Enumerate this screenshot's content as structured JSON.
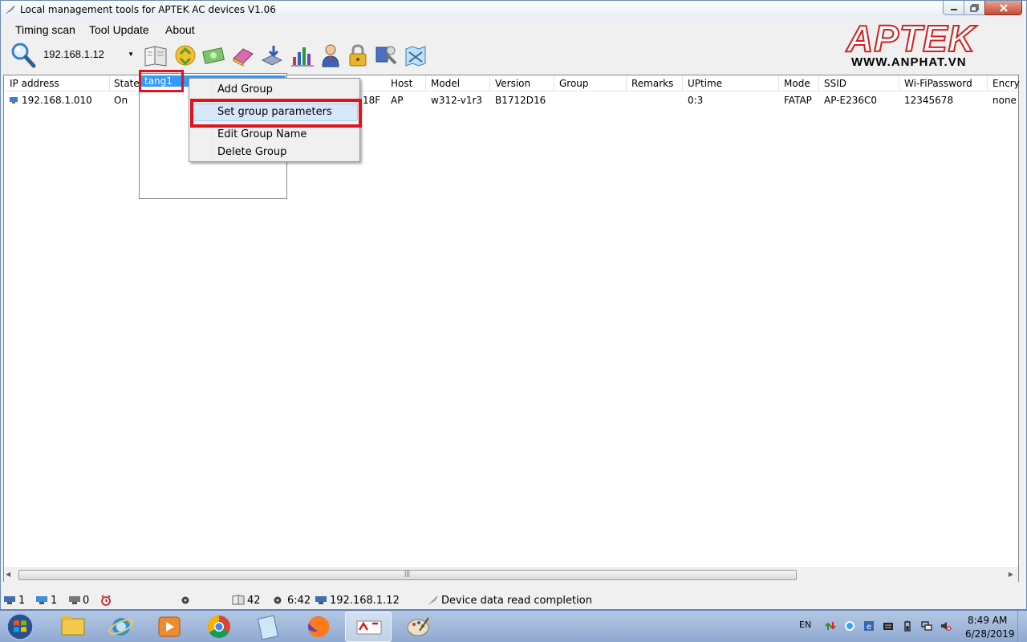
{
  "window": {
    "title": "Local management tools for APTEK AC devices  V1.06"
  },
  "menu": {
    "items": [
      "Timing scan",
      "Tool Update",
      "About"
    ]
  },
  "toolbar": {
    "ip_value": "192.168.1.12",
    "icons": [
      "book-icon",
      "recycle-icon",
      "money-icon",
      "eraser-icon",
      "download-icon",
      "bar-chart-icon",
      "user-icon",
      "lock-icon",
      "tools-icon",
      "map-icon"
    ]
  },
  "logo": {
    "word": "APTEK",
    "url": "WWW.ANPHAT.VN",
    "brand_color": "#d31f1f"
  },
  "table": {
    "columns": [
      "IP address",
      "State",
      "Host",
      "Model",
      "Version",
      "Group",
      "Remarks",
      "UPtime",
      "Mode",
      "SSID",
      "Wi-FiPassword",
      "Encry"
    ],
    "row": {
      "ip": "192.168.1.010",
      "state": "On",
      "mac_tail": "18F",
      "host": "AP",
      "model": "w312-v1r3",
      "version": "B1712D16",
      "group": "",
      "remarks": "",
      "uptime": "0:3",
      "mode": "FATAP",
      "ssid": "AP-E236C0",
      "password": "12345678",
      "encryption": "none"
    }
  },
  "group_list": {
    "selected": "tang1"
  },
  "context_menu": {
    "items": [
      "Add Group",
      "Set group parameters",
      "Edit Group Name",
      "Delete Group"
    ],
    "hovered_index": 1,
    "highlight_color": "#e0121c"
  },
  "statusbar": {
    "count_a": "1",
    "count_b": "1",
    "count_c": "0",
    "book_count": "42",
    "time": "6:42",
    "ip": "192.168.1.12",
    "message": "Device data read completion"
  },
  "taskbar": {
    "lang": "EN",
    "time": "8:49 AM",
    "date": "6/28/2019"
  }
}
